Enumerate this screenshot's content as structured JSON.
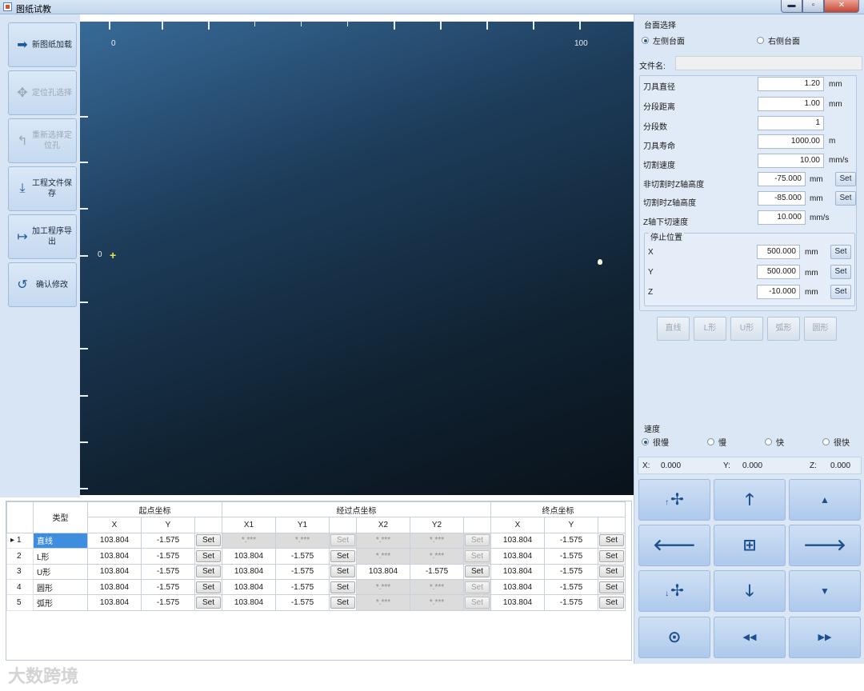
{
  "window": {
    "title": "图纸试教",
    "minimize": "▬",
    "maximize": "▫",
    "close": "✕"
  },
  "toolbar": {
    "load": {
      "label": "新图纸加载",
      "icon": "sign-in-icon",
      "glyph": "➡"
    },
    "locate": {
      "label": "定位孔选择",
      "icon": "crosshair-icon",
      "glyph": "✥"
    },
    "reselect": {
      "label": "重新选择定位孔",
      "icon": "undo-arrow-icon",
      "glyph": "↰"
    },
    "save": {
      "label": "工程文件保存",
      "icon": "download-tray-icon",
      "glyph": "⤓"
    },
    "export": {
      "label": "加工程序导出",
      "icon": "sign-out-icon",
      "glyph": "↦"
    },
    "confirm": {
      "label": "确认修改",
      "icon": "rotate-icon",
      "glyph": "↺"
    }
  },
  "canvas": {
    "x_label_0": "0",
    "x_label_100": "100",
    "y_label_0": "0",
    "origin_marker": "+"
  },
  "table_selection": {
    "title": "台面选择",
    "left": "左侧台面",
    "right": "右侧台面",
    "selected": "left"
  },
  "file": {
    "label": "文件名:",
    "value": ""
  },
  "params": {
    "tool_diameter": {
      "label": "刀具直径",
      "value": "1.20",
      "unit": "mm"
    },
    "segment_distance": {
      "label": "分段距离",
      "value": "1.00",
      "unit": "mm"
    },
    "segment_count": {
      "label": "分段数",
      "value": "1",
      "unit": ""
    },
    "tool_life": {
      "label": "刀具寿命",
      "value": "1000.00",
      "unit": "m"
    },
    "cut_speed": {
      "label": "切割速度",
      "value": "10.00",
      "unit": "mm/s"
    },
    "noncut_z": {
      "label": "非切割时Z轴高度",
      "value": "-75.000",
      "unit": "mm",
      "set": "Set"
    },
    "cut_z": {
      "label": "切割时Z轴高度",
      "value": "-85.000",
      "unit": "mm",
      "set": "Set"
    },
    "z_down_speed": {
      "label": "Z轴下切速度",
      "value": "10.000",
      "unit": "mm/s"
    }
  },
  "stop_position": {
    "title": "停止位置",
    "x": {
      "label": "X",
      "value": "500.000",
      "unit": "mm",
      "set": "Set"
    },
    "y": {
      "label": "Y",
      "value": "500.000",
      "unit": "mm",
      "set": "Set"
    },
    "z": {
      "label": "Z",
      "value": "-10.000",
      "unit": "mm",
      "set": "Set"
    }
  },
  "shape_buttons": [
    "直线",
    "L形",
    "U形",
    "弧形",
    "圆形"
  ],
  "speed": {
    "title": "速度",
    "options": [
      "很慢",
      "慢",
      "快",
      "很快"
    ],
    "selected": "很慢"
  },
  "coords": {
    "x_label": "X:",
    "x_value": "0.000",
    "y_label": "Y:",
    "y_value": "0.000",
    "z_label": "Z:",
    "z_value": "0.000"
  },
  "jog": {
    "spin_up": {
      "prefix": "↑",
      "icon": "fan-icon",
      "glyph": "✢"
    },
    "up": {
      "icon": "arrow-up-icon",
      "glyph": "🡑"
    },
    "z_up": {
      "icon": "triangle-up-icon",
      "glyph": "▲"
    },
    "left": {
      "icon": "arrow-left-icon",
      "glyph": "🡐"
    },
    "center": {
      "icon": "plus-square-icon",
      "glyph": "⊞"
    },
    "right": {
      "icon": "arrow-right-icon",
      "glyph": "🡒"
    },
    "spin_down": {
      "prefix": "↓",
      "icon": "fan-icon",
      "glyph": "✢"
    },
    "down": {
      "icon": "arrow-down-icon",
      "glyph": "🡓"
    },
    "z_down": {
      "icon": "triangle-down-icon",
      "glyph": "▼"
    },
    "home": {
      "icon": "target-rotate-icon",
      "glyph": "⊙"
    },
    "rewind": {
      "icon": "double-left-icon",
      "glyph": "◀◀"
    },
    "forward": {
      "icon": "double-right-icon",
      "glyph": "▶▶"
    }
  },
  "grid": {
    "type_header": "类型",
    "start_header": "起点坐标",
    "via_header": "经过点坐标",
    "end_header": "终点坐标",
    "sub": {
      "x": "X",
      "y": "Y",
      "x1": "X1",
      "y1": "Y1",
      "x2": "X2",
      "y2": "Y2"
    },
    "set": "Set",
    "rows": [
      {
        "n": "1",
        "mark": "▸",
        "type": "直线",
        "sx": "103.804",
        "sy": "-1.575",
        "x1": "*.***",
        "y1": "*.***",
        "x2": "*.***",
        "y2": "*.***",
        "ex": "103.804",
        "ey": "-1.575"
      },
      {
        "n": "2",
        "mark": "",
        "type": "L形",
        "sx": "103.804",
        "sy": "-1.575",
        "x1": "103.804",
        "y1": "-1.575",
        "x2": "*.***",
        "y2": "*.***",
        "ex": "103.804",
        "ey": "-1.575"
      },
      {
        "n": "3",
        "mark": "",
        "type": "U形",
        "sx": "103.804",
        "sy": "-1.575",
        "x1": "103.804",
        "y1": "-1.575",
        "x2": "103.804",
        "y2": "-1.575",
        "ex": "103.804",
        "ey": "-1.575"
      },
      {
        "n": "4",
        "mark": "",
        "type": "圆形",
        "sx": "103.804",
        "sy": "-1.575",
        "x1": "103.804",
        "y1": "-1.575",
        "x2": "*.***",
        "y2": "*.***",
        "ex": "103.804",
        "ey": "-1.575"
      },
      {
        "n": "5",
        "mark": "",
        "type": "弧形",
        "sx": "103.804",
        "sy": "-1.575",
        "x1": "103.804",
        "y1": "-1.575",
        "x2": "*.***",
        "y2": "*.***",
        "ex": "103.804",
        "ey": "-1.575"
      }
    ]
  },
  "watermark": "大数跨境"
}
